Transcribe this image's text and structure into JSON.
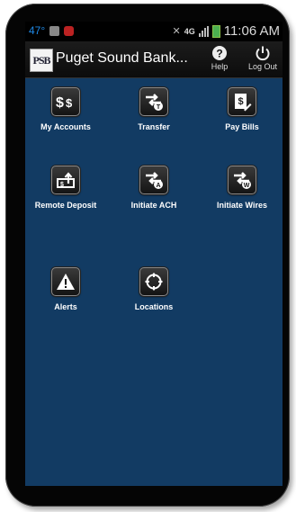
{
  "status_bar": {
    "temperature": "47°",
    "network": "4G",
    "time": "11:06 AM"
  },
  "app_bar": {
    "logo_text": "PSB",
    "title": "Puget Sound Bank...",
    "help_label": "Help",
    "logout_label": "Log Out"
  },
  "menu": {
    "items": [
      {
        "label": "My Accounts",
        "icon": "dollar-icon"
      },
      {
        "label": "Transfer",
        "icon": "transfer-t-icon"
      },
      {
        "label": "Pay Bills",
        "icon": "pay-bill-icon"
      },
      {
        "label": "Remote Deposit",
        "icon": "deposit-icon"
      },
      {
        "label": "Initiate ACH",
        "icon": "transfer-a-icon"
      },
      {
        "label": "Initiate Wires",
        "icon": "transfer-w-icon"
      },
      {
        "label": "Alerts",
        "icon": "warning-icon"
      },
      {
        "label": "Locations",
        "icon": "crosshair-icon"
      }
    ]
  },
  "colors": {
    "background": "#123b63",
    "accent": "#1e88e5"
  }
}
